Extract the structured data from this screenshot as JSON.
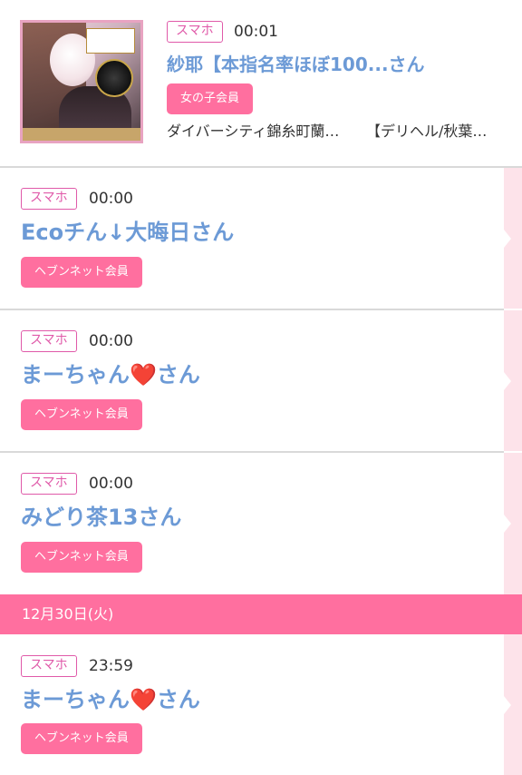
{
  "entries": [
    {
      "device": "スマホ",
      "time": "00:01",
      "name": "紗耶【本指名率ほぼ100...さん",
      "member": "女の子会員",
      "shop": "ダイバーシティ錦糸町蘭…",
      "category": "【デリヘル/秋葉…"
    },
    {
      "device": "スマホ",
      "time": "00:00",
      "name": "Ecoチん↓大晦日さん",
      "member": "ヘブンネット会員"
    },
    {
      "device": "スマホ",
      "time": "00:00",
      "name": "まーちゃん❤️さん",
      "member": "ヘブンネット会員"
    },
    {
      "device": "スマホ",
      "time": "00:00",
      "name": "みどり茶13さん",
      "member": "ヘブンネット会員"
    },
    {
      "device": "スマホ",
      "time": "23:59",
      "name": "まーちゃん❤️さん",
      "member": "ヘブンネット会員"
    }
  ],
  "date_divider": "12月30日(火)",
  "colors": {
    "accent_pink": "#ff6f9f",
    "tag_magenta": "#e05aa9",
    "name_blue": "#6c9ad6",
    "strip_pink": "#fde3ea"
  }
}
